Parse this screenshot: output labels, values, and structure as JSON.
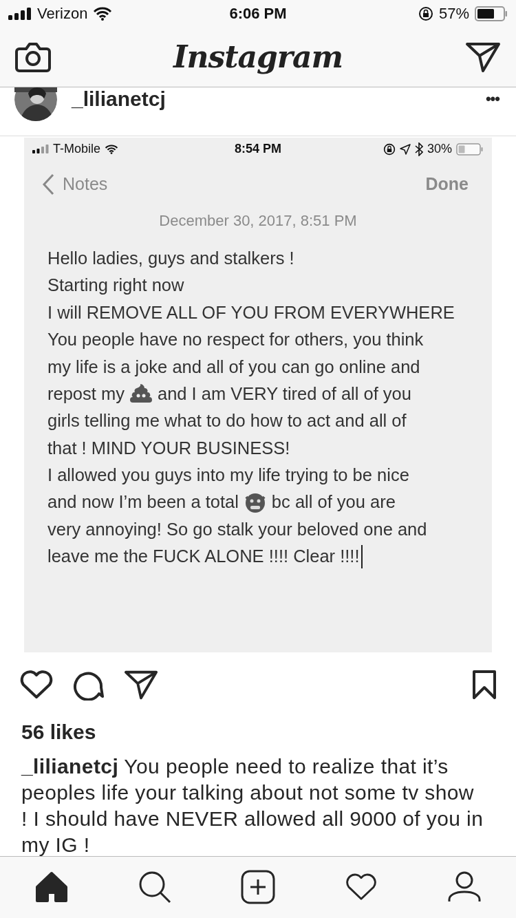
{
  "status_bar": {
    "carrier": "Verizon",
    "time": "6:06 PM",
    "battery": "57%"
  },
  "nav": {
    "title": "Instagram"
  },
  "post": {
    "username": "_lilianetcj",
    "more": "•••",
    "image": {
      "status_bar": {
        "carrier": "T-Mobile",
        "time": "8:54 PM",
        "battery": "30%"
      },
      "back": "Notes",
      "done": "Done",
      "date": "December 30, 2017, 8:51 PM",
      "lines": [
        {
          "parts": [
            {
              "kind": "text",
              "text": "Hello ladies, guys and stalkers !"
            }
          ]
        },
        {
          "parts": [
            {
              "kind": "text",
              "text": "Starting right now"
            }
          ]
        },
        {
          "parts": [
            {
              "kind": "text",
              "text": "I will REMOVE ALL OF YOU FROM EVERYWHERE"
            }
          ]
        },
        {
          "parts": [
            {
              "kind": "text",
              "text": "You people have no respect for others, you think"
            }
          ]
        },
        {
          "parts": [
            {
              "kind": "text",
              "text": "my life is a joke and all of you can go online and"
            }
          ]
        },
        {
          "parts": [
            {
              "kind": "text",
              "text": "repost my"
            },
            {
              "kind": "poop"
            },
            {
              "kind": "text",
              "text": "and I am VERY tired of all of you"
            }
          ]
        },
        {
          "parts": [
            {
              "kind": "text",
              "text": "girls telling me what to do how to act and all of"
            }
          ]
        },
        {
          "parts": [
            {
              "kind": "text",
              "text": "that ! MIND YOUR BUSINESS!"
            }
          ]
        },
        {
          "parts": [
            {
              "kind": "text",
              "text": "I allowed you guys into my life trying to be nice"
            }
          ]
        },
        {
          "parts": [
            {
              "kind": "text",
              "text": "and now I’m been a total"
            },
            {
              "kind": "ogre"
            },
            {
              "kind": "text",
              "text": "bc all of you are"
            }
          ]
        },
        {
          "parts": [
            {
              "kind": "text",
              "text": "very annoying! So go stalk your beloved one and"
            }
          ]
        },
        {
          "parts": [
            {
              "kind": "text",
              "text": "leave me the FUCK ALONE !!!! Clear !!!!"
            },
            {
              "kind": "cursor"
            }
          ]
        }
      ]
    },
    "likes": "56 likes",
    "caption": "**_lilianetcj** You people need to realize that it’s peoples life your talking about not some tv show ! I should have NEVER allowed all 9000 of you in my IG !"
  },
  "tab_bar": [
    {
      "kind": "home",
      "selected": true
    },
    {
      "kind": "search",
      "selected": false
    },
    {
      "kind": "add",
      "selected": false
    },
    {
      "kind": "activity",
      "selected": false
    },
    {
      "kind": "profile",
      "selected": false
    }
  ]
}
